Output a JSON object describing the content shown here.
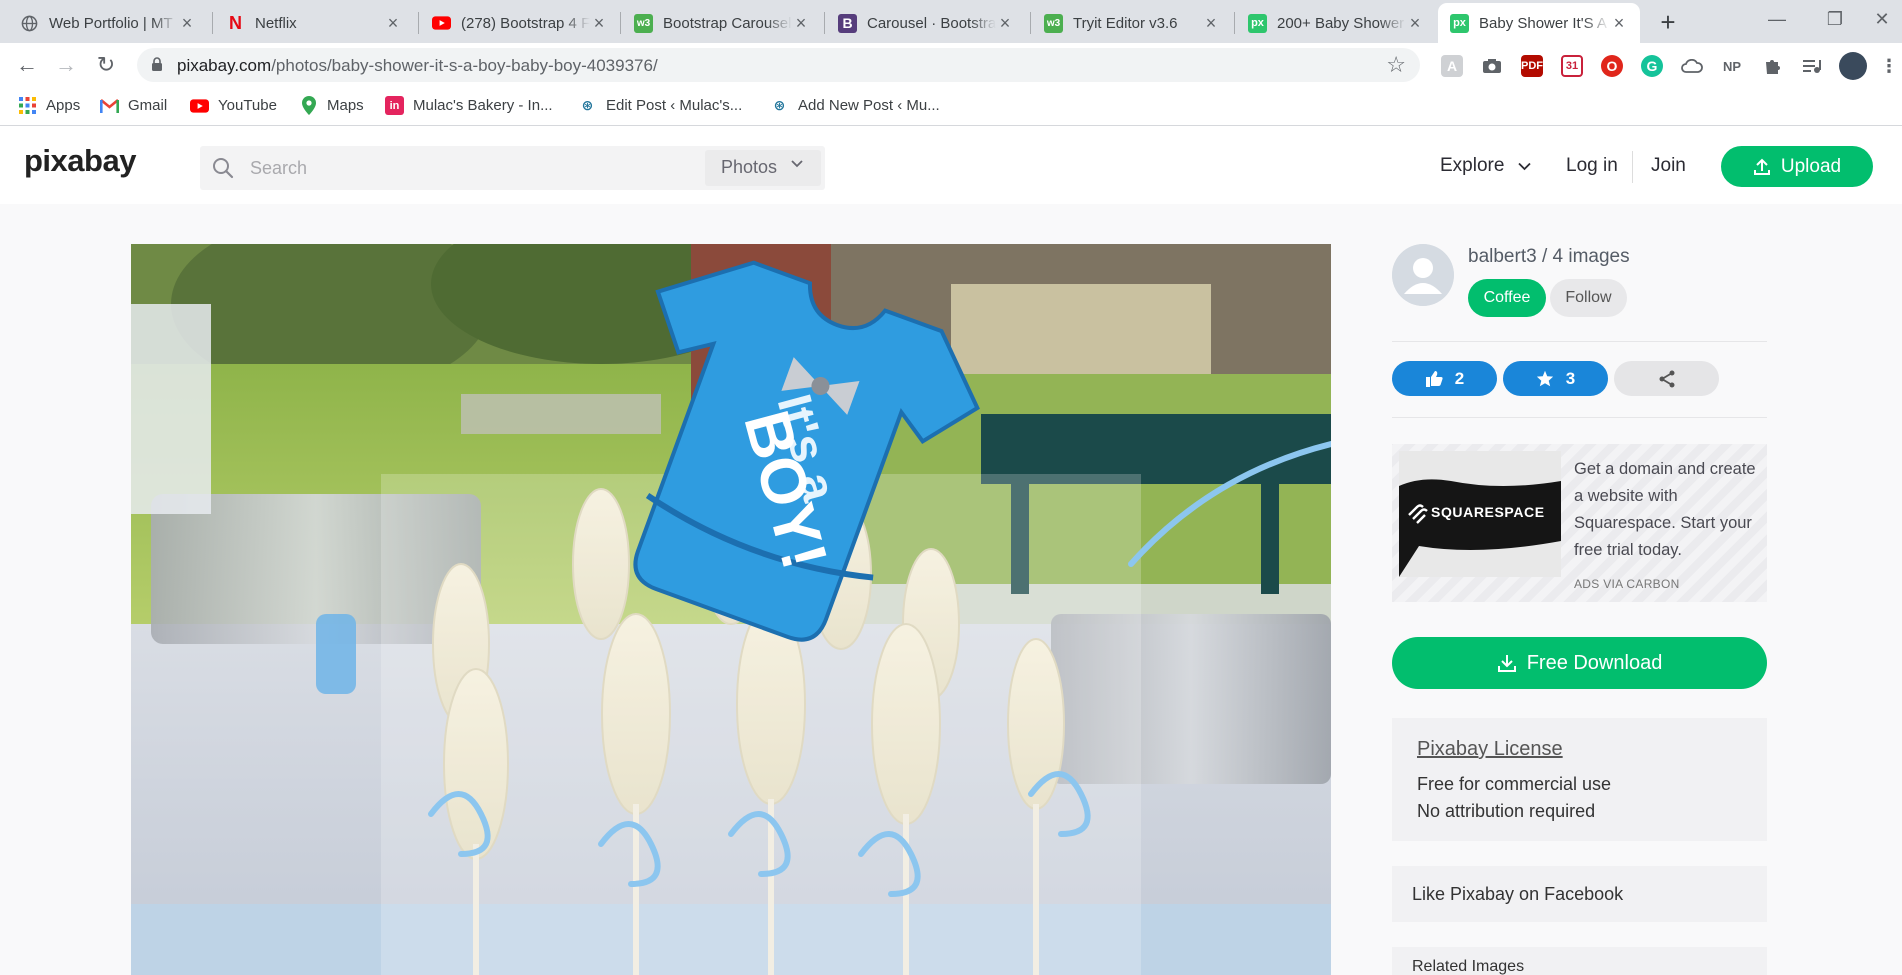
{
  "browser": {
    "tabs": [
      {
        "title": "Web Portfolio | MT",
        "favicon": "globe-icon"
      },
      {
        "title": "Netflix",
        "favicon": "netflix-icon"
      },
      {
        "title": "(278) Bootstrap 4 F",
        "favicon": "youtube-icon"
      },
      {
        "title": "Bootstrap Carousel",
        "favicon": "w3schools-icon"
      },
      {
        "title": "Carousel · Bootstrap",
        "favicon": "bootstrap-icon"
      },
      {
        "title": "Tryit Editor v3.6",
        "favicon": "w3schools-icon"
      },
      {
        "title": "200+ Baby Shower",
        "favicon": "pixabay-icon"
      },
      {
        "title": "Baby Shower It'S A",
        "favicon": "pixabay-icon",
        "active": true
      }
    ],
    "url_host": "pixabay.com",
    "url_path": "/photos/baby-shower-it-s-a-boy-baby-boy-4039376/",
    "bookmarks": [
      {
        "label": "Apps",
        "icon": "apps-grid-icon"
      },
      {
        "label": "Gmail",
        "icon": "gmail-icon"
      },
      {
        "label": "YouTube",
        "icon": "youtube-icon"
      },
      {
        "label": "Maps",
        "icon": "maps-pin-icon"
      },
      {
        "label": "Mulac's Bakery - In...",
        "icon": "invision-icon"
      },
      {
        "label": "Edit Post ‹ Mulac's...",
        "icon": "wordpress-icon"
      },
      {
        "label": "Add New Post ‹ Mu...",
        "icon": "wordpress-icon"
      }
    ],
    "extension_labels": {
      "np": "NP"
    }
  },
  "header": {
    "logo": "pixabay",
    "search_placeholder": "Search",
    "search_type": "Photos",
    "explore": "Explore",
    "login": "Log in",
    "join": "Join",
    "upload": "Upload"
  },
  "photo": {
    "sign_text_1": "It's a",
    "sign_text_2": "BOY!"
  },
  "sidebar": {
    "user": "balbert3 / 4 images",
    "coffee": "Coffee",
    "follow": "Follow",
    "likes": "2",
    "favorites": "3",
    "ad_brand": "SQUARESPACE",
    "ad_text": "Get a domain and create a website with Squarespace. Start your free trial today.",
    "ad_via": "ADS VIA CARBON",
    "download": "Free Download",
    "license_title": "Pixabay License",
    "license_line1": "Free for commercial use",
    "license_line2": "No attribution required",
    "facebook": "Like Pixabay on Facebook",
    "related": "Related Images"
  },
  "colors": {
    "brand_green": "#02be6e",
    "stat_blue": "#1a86d9",
    "share_gray": "#e5e5e7"
  }
}
